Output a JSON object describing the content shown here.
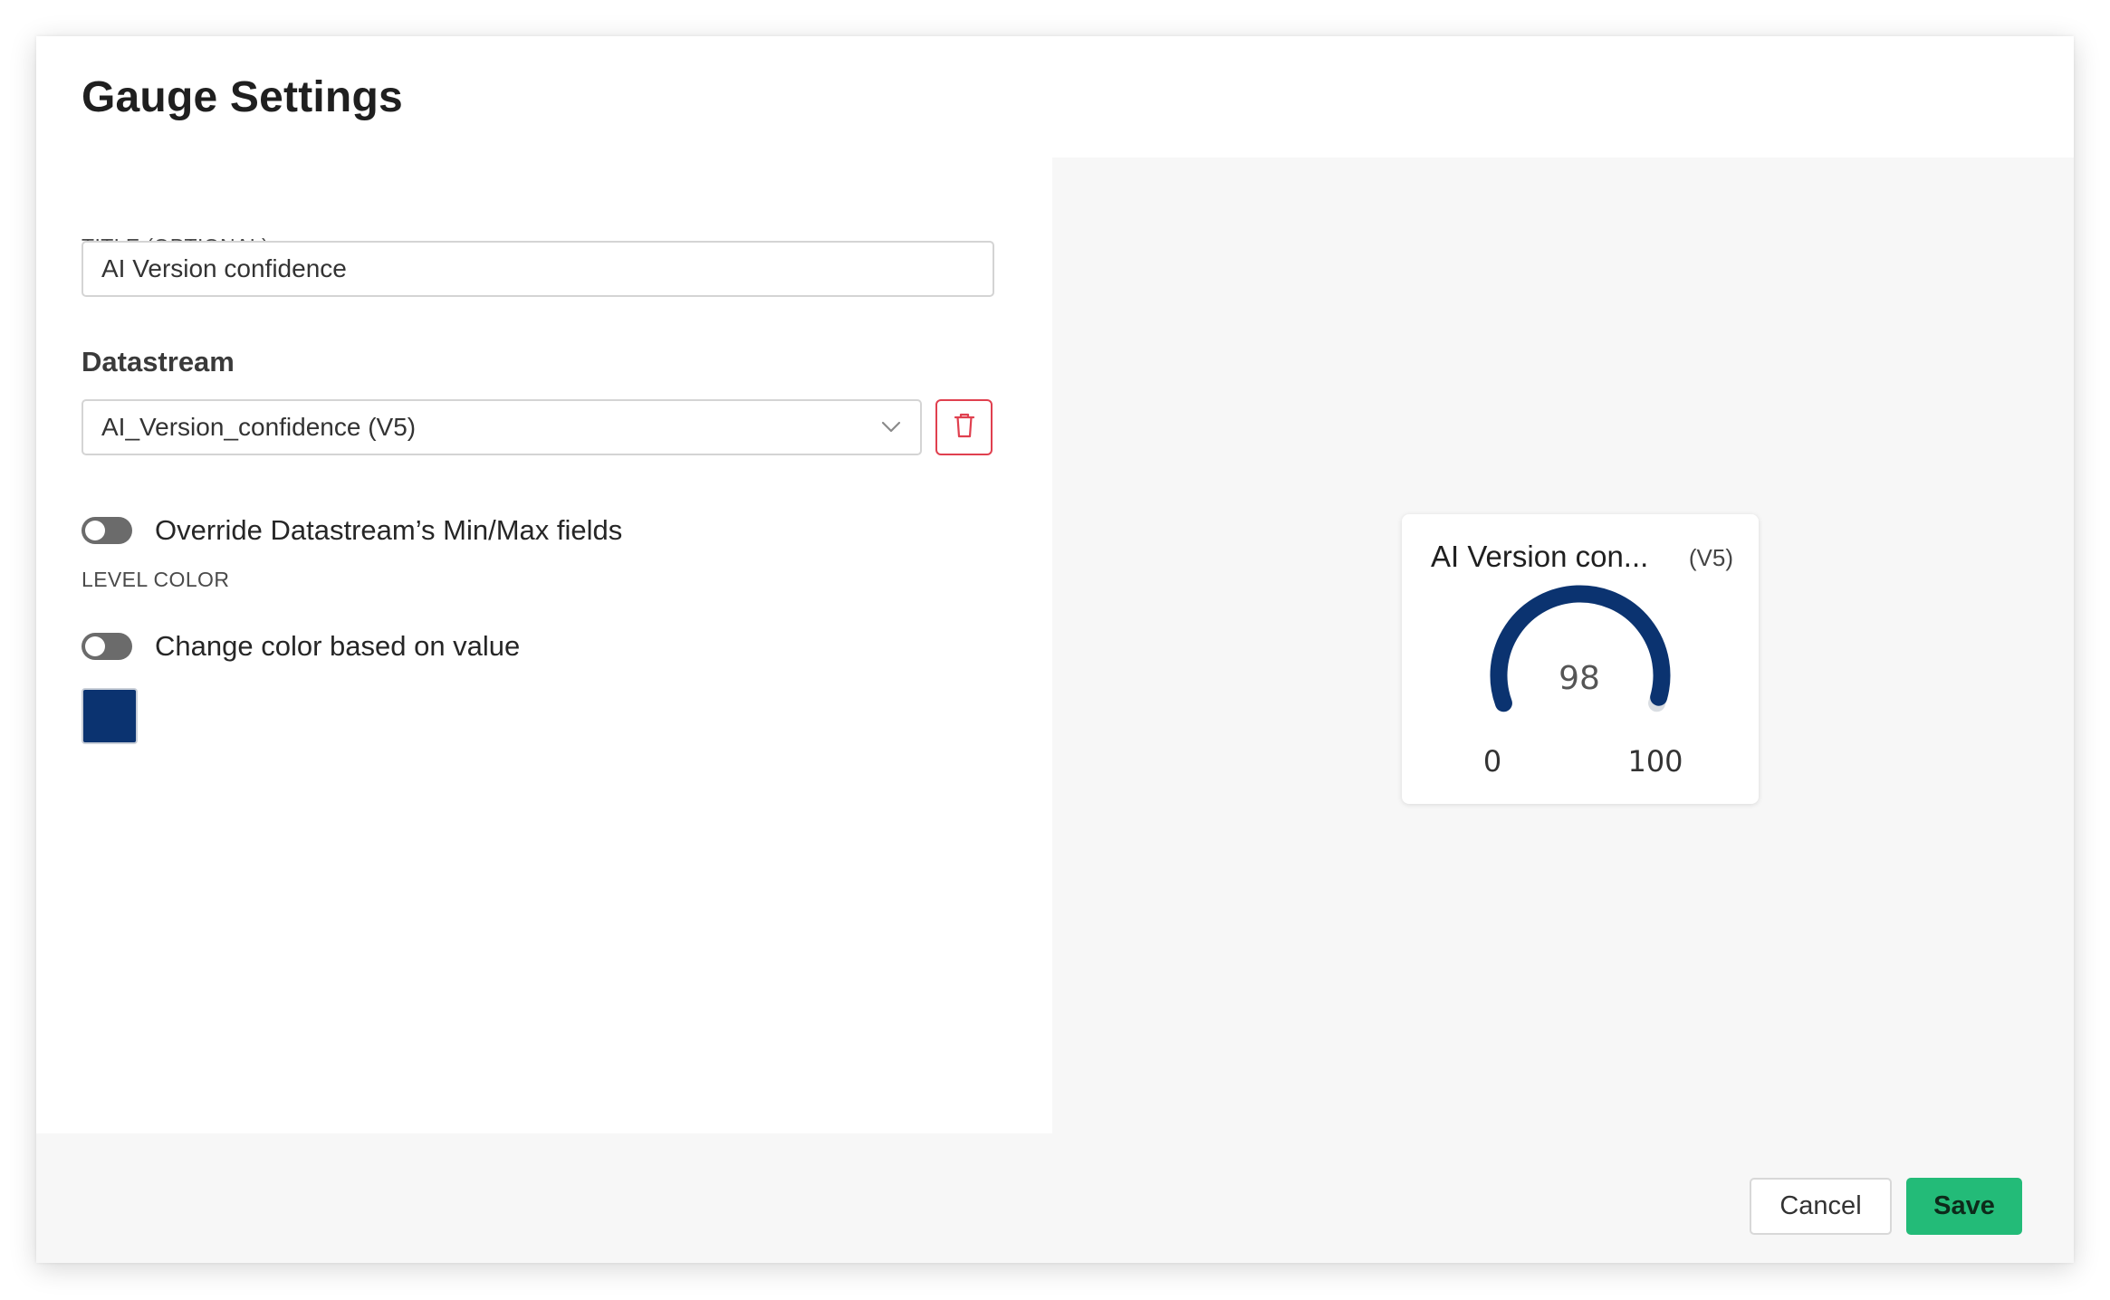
{
  "dialog": {
    "title": "Gauge Settings"
  },
  "form": {
    "title_caption": "TITLE (OPTIONAL)",
    "title_value": "AI Version confidence",
    "datastream_heading": "Datastream",
    "datastream_selected": "AI_Version_confidence (V5)",
    "override_label": "Override Datastream’s Min/Max fields",
    "override_enabled": false,
    "level_color_caption": "LEVEL COLOR",
    "change_color_label": "Change color based on value",
    "change_color_enabled": false,
    "level_color": "#0b3370"
  },
  "preview": {
    "title": "AI Version con...",
    "pin": "(V5)",
    "value": "98",
    "value_number": 98,
    "min": "0",
    "max": "100",
    "min_number": 0,
    "max_number": 100
  },
  "footer": {
    "cancel_label": "Cancel",
    "save_label": "Save",
    "save_color": "#23bb78"
  },
  "colors": {
    "delete_accent": "#e0404f",
    "gauge_track": "#d9dde2"
  },
  "icons": {
    "chevron": "chevron-down-icon",
    "delete": "trash-icon"
  }
}
